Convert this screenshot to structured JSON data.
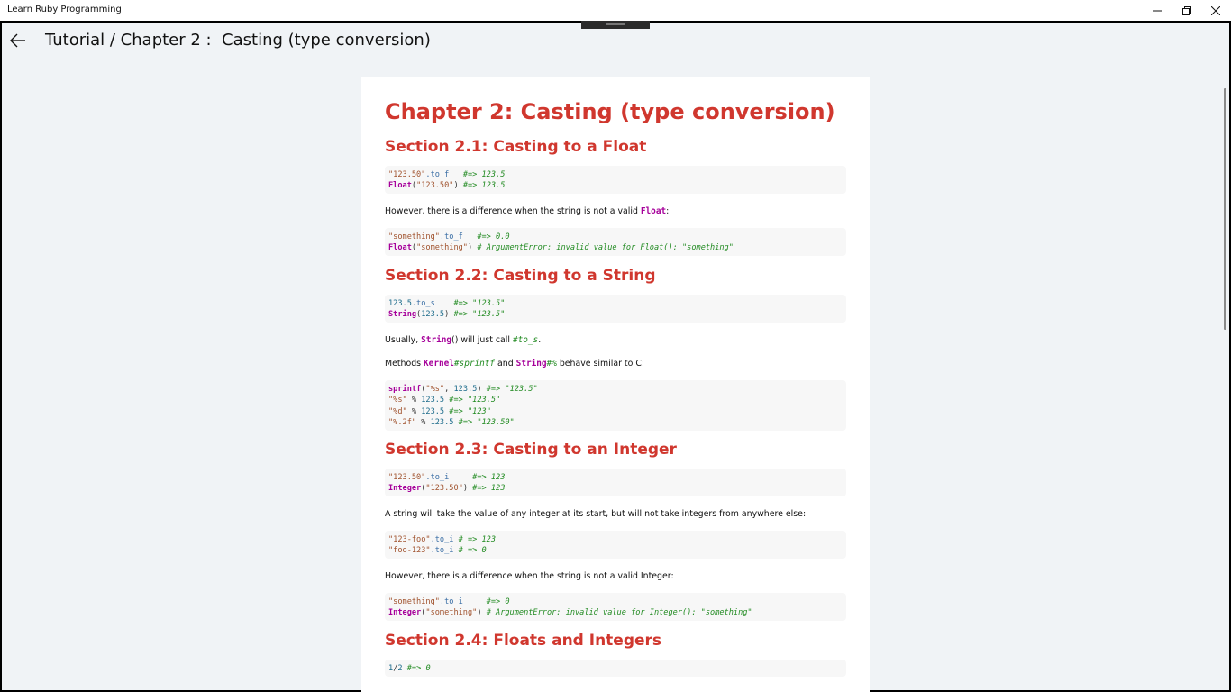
{
  "window": {
    "title": "Learn Ruby Programming",
    "minimize": "–",
    "maximize": "❐",
    "close": "✕"
  },
  "header": {
    "back_icon": "arrow-left-icon",
    "title": "Tutorial / Chapter 2 :  Casting (type conversion)"
  },
  "doc": {
    "chapter_title": "Chapter 2: Casting (type conversion)",
    "s1_title": "Section 2.1: Casting to a Float",
    "s1_code1": [
      {
        "str": "\"123.50\"",
        "meth": ".to_f   ",
        "cmt": "#=> 123.5"
      },
      {
        "kw": "Float",
        "p": "(",
        "str": "\"123.50\"",
        "p2": ") ",
        "cmt": "#=> 123.5"
      }
    ],
    "s1_p1_a": "However, there is a difference when the string is not a valid ",
    "s1_p1_kw": "Float",
    "s1_p1_b": ":",
    "s1_code2_l1_str": "\"something\"",
    "s1_code2_l1_meth": ".to_f   ",
    "s1_code2_l1_cmt": "#=> 0.0",
    "s1_code2_l2_kw": "Float",
    "s1_code2_l2_str": "\"something\"",
    "s1_code2_l2_cmt": "# ArgumentError: invalid value for Float(): \"something\"",
    "s2_title": "Section 2.2: Casting to a String",
    "s2_code1_l1_num": "123.5",
    "s2_code1_l1_meth": ".to_s    ",
    "s2_code1_l1_cmt": "#=> \"123.5\"",
    "s2_code1_l2_kw": "String",
    "s2_code1_l2_num": "123.5",
    "s2_code1_l2_cmt": "#=> \"123.5\"",
    "s2_p1_a": "Usually, ",
    "s2_p1_kw": "String",
    "s2_p1_b": "() will just call ",
    "s2_p1_code": "#to_s",
    "s2_p1_c": ".",
    "s2_p2_a": "Methods ",
    "s2_p2_kw1": "Kernel",
    "s2_p2_code1": "#sprintf",
    "s2_p2_b": " and ",
    "s2_p2_kw2": "String",
    "s2_p2_code2": "#%",
    "s2_p2_c": " behave similar to C:",
    "s2_code2": {
      "l1_kw": "sprintf",
      "l1_str": "\"%s\"",
      "l1_num": "123.5",
      "l1_cmt": "#=> \"123.5\"",
      "l2_str": "\"%s\"",
      "l2_num": "123.5",
      "l2_cmt": "#=> \"123.5\"",
      "l3_str": "\"%d\"",
      "l3_num": "123.5",
      "l3_cmt": "#=> \"123\"",
      "l4_str": "\"%.2f\"",
      "l4_num": "123.5",
      "l4_cmt": "#=> \"123.50\""
    },
    "s3_title": "Section 2.3: Casting to an Integer",
    "s3_code1_l1_str": "\"123.50\"",
    "s3_code1_l1_meth": ".to_i     ",
    "s3_code1_l1_cmt": "#=> 123",
    "s3_code1_l2_kw": "Integer",
    "s3_code1_l2_str": "\"123.50\"",
    "s3_code1_l2_cmt": "#=> 123",
    "s3_p1": "A string will take the value of any integer at its start, but will not take integers from anywhere else:",
    "s3_code2_l1_str": "\"123-foo\"",
    "s3_code2_l1_meth": ".to_i ",
    "s3_code2_l1_cmt": "# => 123",
    "s3_code2_l2_str": "\"foo-123\"",
    "s3_code2_l2_meth": ".to_i ",
    "s3_code2_l2_cmt": "# => 0",
    "s3_p2": "However, there is a difference when the string is not a valid Integer:",
    "s3_code3_l1_str": "\"something\"",
    "s3_code3_l1_meth": ".to_i     ",
    "s3_code3_l1_cmt": "#=> 0",
    "s3_code3_l2_kw": "Integer",
    "s3_code3_l2_str": "\"something\"",
    "s3_code3_l2_cmt": "# ArgumentError: invalid value for Integer(): \"something\"",
    "s4_title": "Section 2.4: Floats and Integers",
    "s4_code1_num1": "1",
    "s4_code1_op": "/",
    "s4_code1_num2": "2",
    "s4_code1_cmt": "#=> 0"
  }
}
